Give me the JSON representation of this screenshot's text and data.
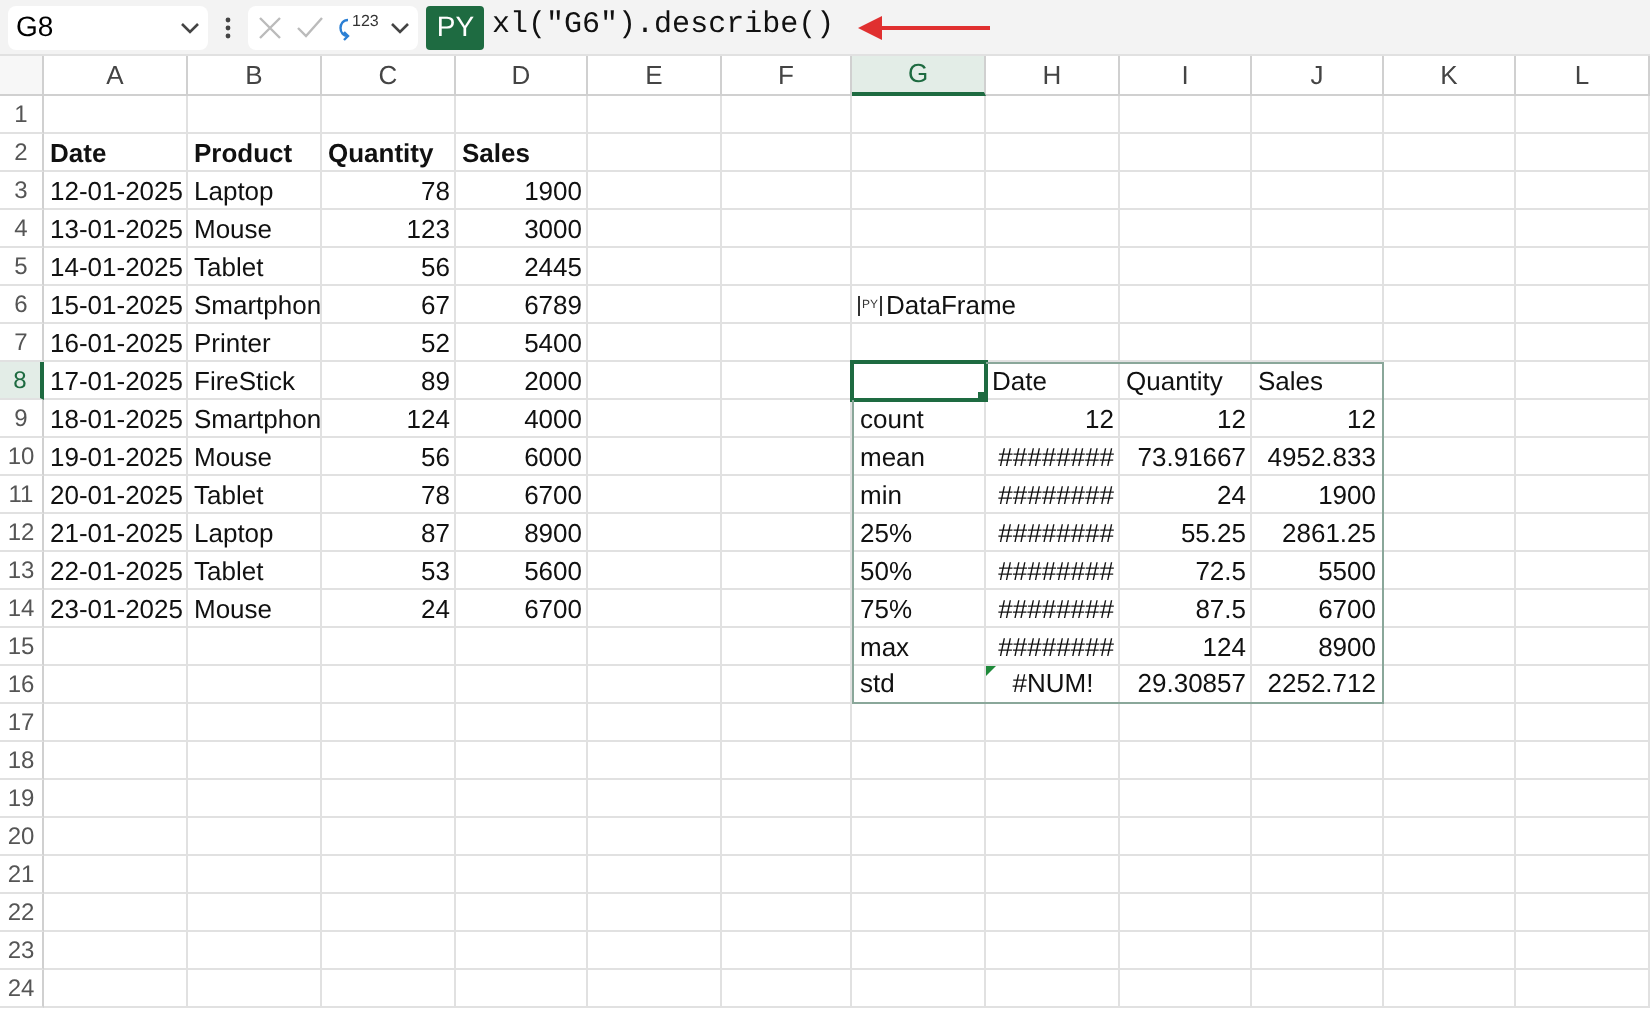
{
  "name_box": {
    "value": "G8"
  },
  "formula_bar": {
    "function_label": "123",
    "language_badge": "PY",
    "formula": "xl(\"G6\").describe()"
  },
  "columns": [
    {
      "label": "A",
      "selected": false
    },
    {
      "label": "B",
      "selected": false
    },
    {
      "label": "C",
      "selected": false
    },
    {
      "label": "D",
      "selected": false
    },
    {
      "label": "E",
      "selected": false
    },
    {
      "label": "F",
      "selected": false
    },
    {
      "label": "G",
      "selected": true
    },
    {
      "label": "H",
      "selected": false
    },
    {
      "label": "I",
      "selected": false
    },
    {
      "label": "J",
      "selected": false
    },
    {
      "label": "K",
      "selected": false
    },
    {
      "label": "L",
      "selected": false
    }
  ],
  "row_headers": [
    {
      "label": "1",
      "selected": false
    },
    {
      "label": "2",
      "selected": false
    },
    {
      "label": "3",
      "selected": false
    },
    {
      "label": "4",
      "selected": false
    },
    {
      "label": "5",
      "selected": false
    },
    {
      "label": "6",
      "selected": false
    },
    {
      "label": "7",
      "selected": false
    },
    {
      "label": "8",
      "selected": true
    },
    {
      "label": "9",
      "selected": false
    },
    {
      "label": "10",
      "selected": false
    },
    {
      "label": "11",
      "selected": false
    },
    {
      "label": "12",
      "selected": false
    },
    {
      "label": "13",
      "selected": false
    },
    {
      "label": "14",
      "selected": false
    },
    {
      "label": "15",
      "selected": false
    },
    {
      "label": "16",
      "selected": false
    },
    {
      "label": "17",
      "selected": false
    },
    {
      "label": "18",
      "selected": false
    },
    {
      "label": "19",
      "selected": false
    },
    {
      "label": "20",
      "selected": false
    },
    {
      "label": "21",
      "selected": false
    },
    {
      "label": "22",
      "selected": false
    },
    {
      "label": "23",
      "selected": false
    },
    {
      "label": "24",
      "selected": false
    }
  ],
  "sales_table": {
    "columns": [
      {
        "label": "Date",
        "kind": "text"
      },
      {
        "label": "Product",
        "kind": "text"
      },
      {
        "label": "Quantity",
        "kind": "number"
      },
      {
        "label": "Sales",
        "kind": "number"
      }
    ],
    "rows": [
      [
        "12-01-2025",
        "Laptop",
        "78",
        "1900"
      ],
      [
        "13-01-2025",
        "Mouse",
        "123",
        "3000"
      ],
      [
        "14-01-2025",
        "Tablet",
        "56",
        "2445"
      ],
      [
        "15-01-2025",
        "Smartphon",
        "67",
        "6789"
      ],
      [
        "16-01-2025",
        "Printer",
        "52",
        "5400"
      ],
      [
        "17-01-2025",
        "FireStick",
        "89",
        "2000"
      ],
      [
        "18-01-2025",
        "Smartphon",
        "124",
        "4000"
      ],
      [
        "19-01-2025",
        "Mouse",
        "56",
        "6000"
      ],
      [
        "20-01-2025",
        "Tablet",
        "78",
        "6700"
      ],
      [
        "21-01-2025",
        "Laptop",
        "87",
        "8900"
      ],
      [
        "22-01-2025",
        "Tablet",
        "53",
        "5600"
      ],
      [
        "23-01-2025",
        "Mouse",
        "24",
        "6700"
      ]
    ]
  },
  "python_output": {
    "badge": "PY",
    "label": "DataFrame"
  },
  "describe_table": {
    "corner_cell": {
      "selected": true
    },
    "columns": [
      "Date",
      "Quantity",
      "Sales"
    ],
    "rows": [
      {
        "label": "count",
        "values": [
          {
            "text": "12",
            "kind": "number"
          },
          {
            "text": "12",
            "kind": "number"
          },
          {
            "text": "12",
            "kind": "number"
          }
        ]
      },
      {
        "label": "mean",
        "values": [
          {
            "text": "########",
            "kind": "number"
          },
          {
            "text": "73.91667",
            "kind": "number"
          },
          {
            "text": "4952.833",
            "kind": "number"
          }
        ]
      },
      {
        "label": "min",
        "values": [
          {
            "text": "########",
            "kind": "number"
          },
          {
            "text": "24",
            "kind": "number"
          },
          {
            "text": "1900",
            "kind": "number"
          }
        ]
      },
      {
        "label": "25%",
        "values": [
          {
            "text": "########",
            "kind": "number"
          },
          {
            "text": "55.25",
            "kind": "number"
          },
          {
            "text": "2861.25",
            "kind": "number"
          }
        ]
      },
      {
        "label": "50%",
        "values": [
          {
            "text": "########",
            "kind": "number"
          },
          {
            "text": "72.5",
            "kind": "number"
          },
          {
            "text": "5500",
            "kind": "number"
          }
        ]
      },
      {
        "label": "75%",
        "values": [
          {
            "text": "########",
            "kind": "number"
          },
          {
            "text": "87.5",
            "kind": "number"
          },
          {
            "text": "6700",
            "kind": "number"
          }
        ]
      },
      {
        "label": "max",
        "values": [
          {
            "text": "########",
            "kind": "number"
          },
          {
            "text": "124",
            "kind": "number"
          },
          {
            "text": "8900",
            "kind": "number"
          }
        ]
      },
      {
        "label": "std",
        "values": [
          {
            "text": "#NUM!",
            "kind": "error"
          },
          {
            "text": "29.30857",
            "kind": "number"
          },
          {
            "text": "2252.712",
            "kind": "number"
          }
        ]
      }
    ]
  }
}
